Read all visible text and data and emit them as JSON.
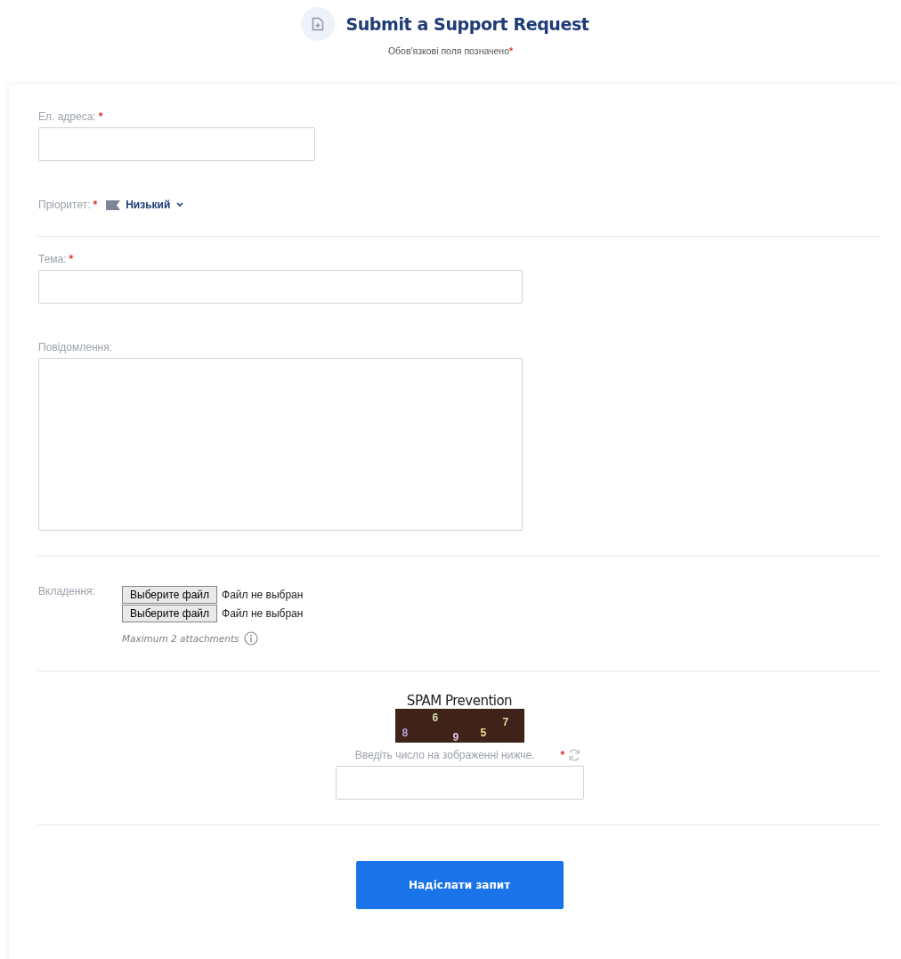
{
  "header": {
    "title": "Submit a Support Request",
    "required_note": "Обов'язкові поля позначено",
    "required_mark": "*"
  },
  "sections": [
    {
      "fields": [
        {
          "kind": "email",
          "label": "Ел. адреса:",
          "required_mark": "*"
        },
        {
          "kind": "priority",
          "label": "Пріоритет:",
          "required_mark": "*",
          "value": "Низький"
        }
      ]
    },
    {
      "fields": [
        {
          "kind": "text",
          "label": "Тема:",
          "required_mark": "*"
        },
        {
          "kind": "textarea",
          "label": "Повідомлення:"
        }
      ]
    },
    {
      "fields": [
        {
          "kind": "attachments",
          "label": "Вкладення:",
          "files": [
            {
              "button": "Выберите файл",
              "status": "Файл не выбран"
            },
            {
              "button": "Выберите файл",
              "status": "Файл не выбран"
            }
          ],
          "note": "Maximum 2 attachments"
        }
      ]
    },
    {
      "fields": [
        {
          "kind": "captcha",
          "title": "SPAM Prevention",
          "digits": [
            {
              "text": "8",
              "color": "#b9a3d6"
            },
            {
              "text": "6",
              "color": "#cfe0b0"
            },
            {
              "text": "9",
              "color": "#e2c3dc"
            },
            {
              "text": "5",
              "color": "#f3e08c"
            },
            {
              "text": "7",
              "color": "#d7df9a"
            }
          ],
          "label": "Введіть число на зображенні нижче.",
          "required_mark": "*"
        }
      ]
    },
    {
      "fields": [
        {
          "kind": "submit",
          "label": "Надіслати запит"
        }
      ]
    }
  ]
}
